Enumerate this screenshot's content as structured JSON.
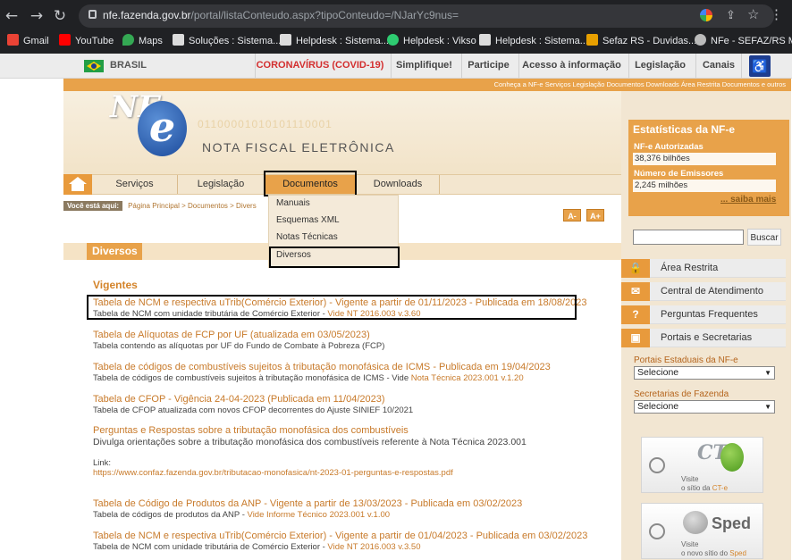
{
  "browser": {
    "url_host": "nfe.fazenda.gov.br",
    "url_path": "/portal/listaConteudo.aspx?tipoConteudo=/NJarYc9nus=",
    "bookmarks": [
      "Gmail",
      "YouTube",
      "Maps",
      "Soluções : Sistema...",
      "Helpdesk : Sistema...",
      "Helpdesk : Vikso",
      "Helpdesk : Sistema...",
      "Sefaz RS - Duvidas...",
      "NFe - SEFAZ/RS Mo..."
    ]
  },
  "govbar": {
    "brasil": "BRASIL",
    "items": [
      "CORONAVÍRUS (COVID-19)",
      "Simplifique!",
      "Participe",
      "Acesso à informação",
      "Legislação",
      "Canais"
    ]
  },
  "header": {
    "toplinks": "Conheça a NF-e   Serviços   Legislação   Documentos   Downloads   Área Restrita   Documentos e outros",
    "logo_nf": "NF",
    "logo_e": "e",
    "title": "NOTA FISCAL ELETRÔNICA",
    "binary": "01100001010101110001"
  },
  "nav": {
    "items": [
      "Serviços",
      "Legislação",
      "Documentos",
      "Downloads"
    ]
  },
  "breadcrumb": {
    "label": "Você está aqui:",
    "path": "Página Principal > Documentos > Divers"
  },
  "font_buttons": [
    "A-",
    "A+"
  ],
  "dropdown": [
    "Manuais",
    "Esquemas XML",
    "Notas Técnicas",
    "Diversos"
  ],
  "section": {
    "title": "Diversos",
    "subtitle": "Vigentes"
  },
  "items": [
    {
      "title": "Tabela de NCM e respectiva uTrib(Comércio Exterior) - Vigente a partir de 01/11/2023 - Publicada em 18/08/2023",
      "desc": "Tabela de NCM com unidade tributária de Comércio Exterior - ",
      "link": "Vide NT 2016.003 v.3.60"
    },
    {
      "title": "Tabela de Alíquotas de FCP por UF (atualizada em 03/05/2023)",
      "desc": "Tabela contendo as alíquotas por UF do Fundo de Combate à Pobreza (FCP)",
      "link": ""
    },
    {
      "title": "Tabela de códigos de combustíveis sujeitos à tributação monofásica de ICMS - Publicada em 19/04/2023",
      "desc": "Tabela de códigos de combustíveis sujeitos à tributação monofásica de ICMS - Vide ",
      "link": "Nota Técnica 2023.001 v.1.20"
    },
    {
      "title": "Tabela de CFOP - Vigência 24-04-2023 (Publicada em 11/04/2023)",
      "desc": "Tabela de CFOP atualizada com novos CFOP decorrentes do Ajuste SINIEF 10/2021",
      "link": ""
    },
    {
      "title": "Perguntas e Respostas sobre a tributação monofásica dos combustíveis",
      "desc": "Divulga orientações sobre a tributação monofásica dos combustíveis referente à Nota Técnica 2023.001",
      "link": ""
    },
    {
      "title": "Tabela de Código de Produtos da ANP - Vigente a partir de 13/03/2023 - Publicada em 03/02/2023",
      "desc": "Tabela de códigos de produtos da ANP - ",
      "link": "Vide Informe Técnico 2023.001 v.1.00"
    },
    {
      "title": "Tabela de NCM e respectiva uTrib(Comércio Exterior) - Vigente a partir de 01/04/2023 - Publicada em 03/02/2023",
      "desc": "Tabela de NCM com unidade tributária de Comércio Exterior - ",
      "link": "Vide NT 2016.003 v.3.50"
    }
  ],
  "link_label": "Link:",
  "link_url": "https://www.confaz.fazenda.gov.br/tributacao-monofasica/nt-2023-01-perguntas-e-respostas.pdf",
  "sidebar": {
    "stats_title": "Estatísticas da NF-e",
    "authorized_label": "NF-e Autorizadas",
    "authorized_value": "38,376 bilhões",
    "emitters_label": "Número de Emissores",
    "emitters_value": "2,245 milhões",
    "saiba_mais": "... saiba mais",
    "search_button": "Buscar",
    "buttons": [
      "Área Restrita",
      "Central de Atendimento",
      "Perguntas Frequentes",
      "Portais e Secretarias"
    ],
    "portais_label": "Portais Estaduais da NF-e",
    "secretarias_label": "Secretarias de Fazenda",
    "select_value": "Selecione",
    "cte_logo": "CT",
    "cte_text1": "Visite",
    "cte_text2": "o sítio da ",
    "cte_link": "CT-e",
    "sped_logo": "Sped",
    "sped_text1": "Visite",
    "sped_text2": "o novo sítio do ",
    "sped_link": "Sped"
  }
}
